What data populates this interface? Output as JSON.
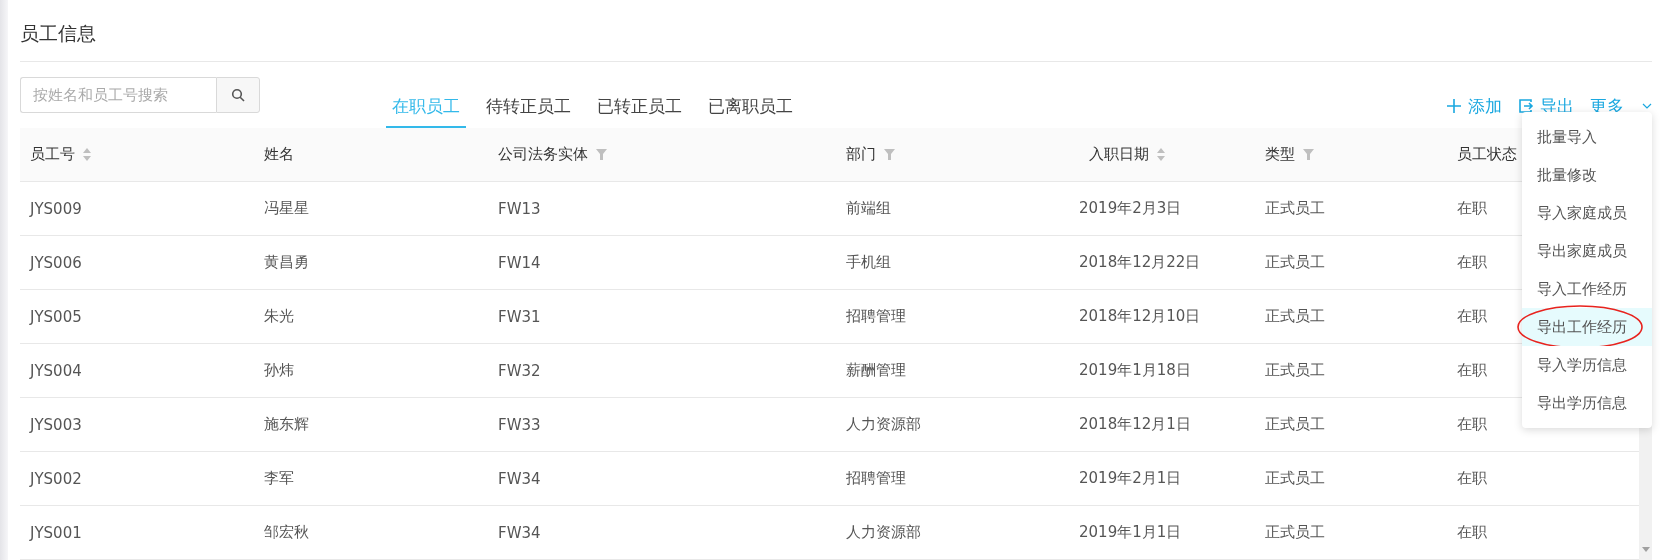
{
  "page_title": "员工信息",
  "search": {
    "placeholder": "按姓名和员工号搜索"
  },
  "tabs": [
    {
      "label": "在职员工",
      "selected": true
    },
    {
      "label": "待转正员工",
      "selected": false
    },
    {
      "label": "已转正员工",
      "selected": false
    },
    {
      "label": "已离职员工",
      "selected": false
    }
  ],
  "actions": [
    {
      "kind": "add",
      "label": "添加"
    },
    {
      "kind": "export",
      "label": "导出"
    },
    {
      "kind": "more",
      "label": "更多"
    }
  ],
  "table": {
    "columns": [
      {
        "label": "员工号",
        "kind": "sort"
      },
      {
        "label": "姓名",
        "kind": "plain"
      },
      {
        "label": "公司法务实体",
        "kind": "filter"
      },
      {
        "label": "部门",
        "kind": "filter"
      },
      {
        "label": "入职日期",
        "kind": "sort"
      },
      {
        "label": "类型",
        "kind": "filter"
      },
      {
        "label": "员工状态",
        "kind": "plain"
      }
    ],
    "rows": [
      [
        "JYS009",
        "冯星星",
        "FW13",
        "前端组",
        "2019年2月3日",
        "正式员工",
        "在职"
      ],
      [
        "JYS006",
        "黄昌勇",
        "FW14",
        "手机组",
        "2018年12月22日",
        "正式员工",
        "在职"
      ],
      [
        "JYS005",
        "朱光",
        "FW31",
        "招聘管理",
        "2018年12月10日",
        "正式员工",
        "在职"
      ],
      [
        "JYS004",
        "孙炜",
        "FW32",
        "薪酬管理",
        "2019年1月18日",
        "正式员工",
        "在职"
      ],
      [
        "JYS003",
        "施东辉",
        "FW33",
        "人力资源部",
        "2018年12月1日",
        "正式员工",
        "在职"
      ],
      [
        "JYS002",
        "李军",
        "FW34",
        "招聘管理",
        "2019年2月1日",
        "正式员工",
        "在职"
      ],
      [
        "JYS001",
        "邹宏秋",
        "FW34",
        "人力资源部",
        "2019年1月1日",
        "正式员工",
        "在职"
      ]
    ]
  },
  "more_menu": [
    {
      "label": "批量导入",
      "selected": false,
      "circled": false
    },
    {
      "label": "批量修改",
      "selected": false,
      "circled": false
    },
    {
      "label": "导入家庭成员",
      "selected": false,
      "circled": false
    },
    {
      "label": "导出家庭成员",
      "selected": false,
      "circled": false
    },
    {
      "label": "导入工作经历",
      "selected": false,
      "circled": false
    },
    {
      "label": "导出工作经历",
      "selected": true,
      "circled": true
    },
    {
      "label": "导入学历信息",
      "selected": false,
      "circled": false
    },
    {
      "label": "导出学历信息",
      "selected": false,
      "circled": false
    }
  ]
}
